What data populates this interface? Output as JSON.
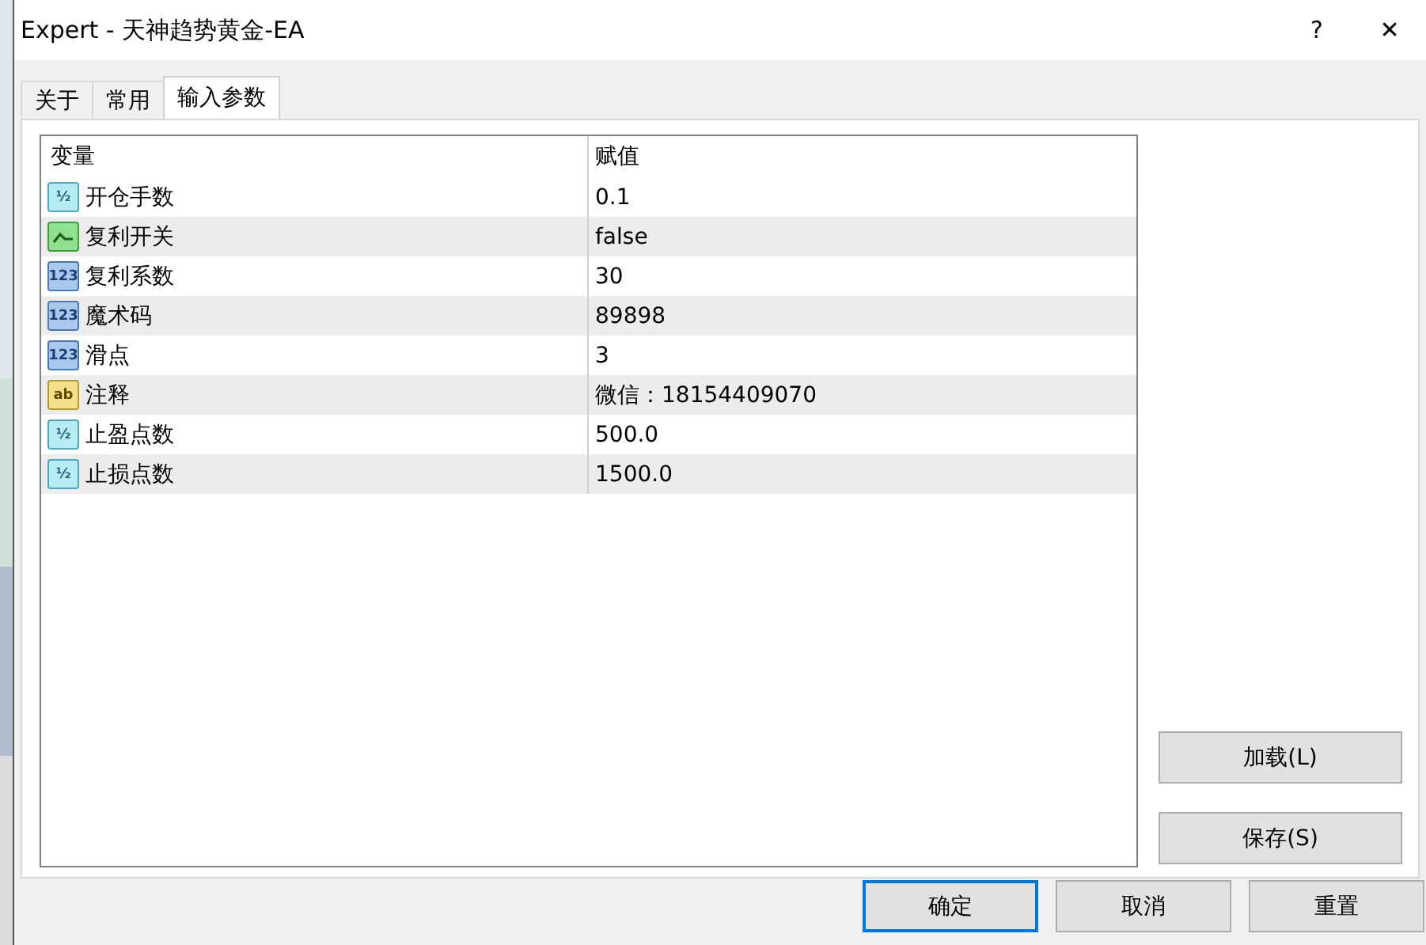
{
  "window": {
    "title": "Expert - 天神趋势黄金-EA",
    "help_button": "?",
    "close_button": "✕"
  },
  "tabs": [
    {
      "label": "关于",
      "selected": false
    },
    {
      "label": "常用",
      "selected": false
    },
    {
      "label": "输入参数",
      "selected": true
    }
  ],
  "table": {
    "columns": [
      "变量",
      "赋值"
    ],
    "rows": [
      {
        "kind": "double",
        "badge": "½",
        "name": "开仓手数",
        "value": "0.1"
      },
      {
        "kind": "bool",
        "name": "复利开关",
        "value": "false"
      },
      {
        "kind": "int",
        "badge": "123",
        "name": "复利系数",
        "value": "30"
      },
      {
        "kind": "int",
        "badge": "123",
        "name": "魔术码",
        "value": "89898"
      },
      {
        "kind": "int",
        "badge": "123",
        "name": "滑点",
        "value": "3"
      },
      {
        "kind": "string",
        "badge": "ab",
        "name": "注释",
        "value": "微信：18154409070"
      },
      {
        "kind": "double",
        "badge": "½",
        "name": "止盈点数",
        "value": "500.0"
      },
      {
        "kind": "double",
        "badge": "½",
        "name": "止损点数",
        "value": "1500.0"
      }
    ]
  },
  "side_buttons": [
    "加载(L)",
    "保存(S)"
  ],
  "buttons": [
    {
      "label": "确定",
      "default": true
    },
    {
      "label": "取消",
      "default": false
    },
    {
      "label": "重置",
      "default": false
    }
  ]
}
